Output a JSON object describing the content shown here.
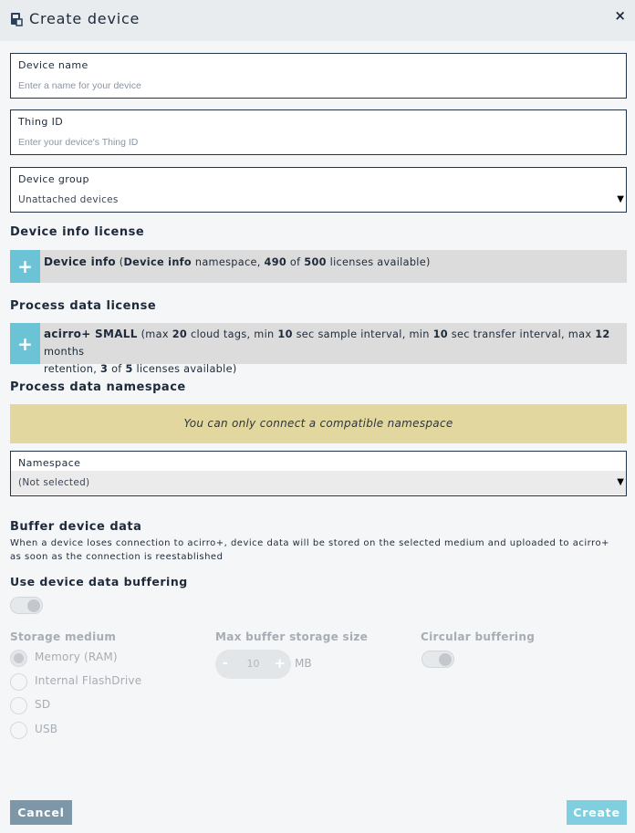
{
  "header": {
    "title": "Create device",
    "close": "×",
    "icon": "device-icon"
  },
  "device_name": {
    "label": "Device name",
    "placeholder": "Enter a name for your device"
  },
  "thing_id": {
    "label": "Thing ID",
    "placeholder": "Enter your device's Thing ID"
  },
  "device_group": {
    "label": "Device group",
    "value": "Unattached devices"
  },
  "device_info_license": {
    "title": "Device info license",
    "name": "Device info",
    "ns_name": "Device info",
    "ns_text": " namespace, ",
    "available": "490",
    "of": " of ",
    "total": "500",
    "suffix": " licenses available)"
  },
  "process_data_license": {
    "title": "Process data license",
    "name": "acirro+ SMALL",
    "t1": " (max ",
    "cloud_tags": "20",
    "t2": " cloud tags, min ",
    "sample_interval": "10",
    "t3": " sec sample interval, min ",
    "transfer_interval": "10",
    "t4": " sec transfer interval, max ",
    "retention": "12",
    "t5": " months",
    "t6": "retention, ",
    "available": "3",
    "of": " of ",
    "total": "5",
    "suffix": " licenses available)"
  },
  "process_data_namespace": {
    "title": "Process data namespace",
    "notice": "You can only connect a compatible namespace",
    "label": "Namespace",
    "value": "(Not selected)"
  },
  "buffer": {
    "title": "Buffer device data",
    "description": "When a device loses connection to acirro+, device data will be stored on the selected medium and uploaded to acirro+ as soon as the connection is reestablished",
    "use_label": "Use device data buffering",
    "storage_title": "Storage medium",
    "storage_options": [
      "Memory (RAM)",
      "Internal FlashDrive",
      "SD",
      "USB"
    ],
    "selected_storage": "Memory (RAM)",
    "max_size_title": "Max buffer storage size",
    "max_size_value": "10",
    "max_size_unit": "MB",
    "circular_title": "Circular buffering"
  },
  "actions": {
    "cancel": "Cancel",
    "create": "Create"
  }
}
